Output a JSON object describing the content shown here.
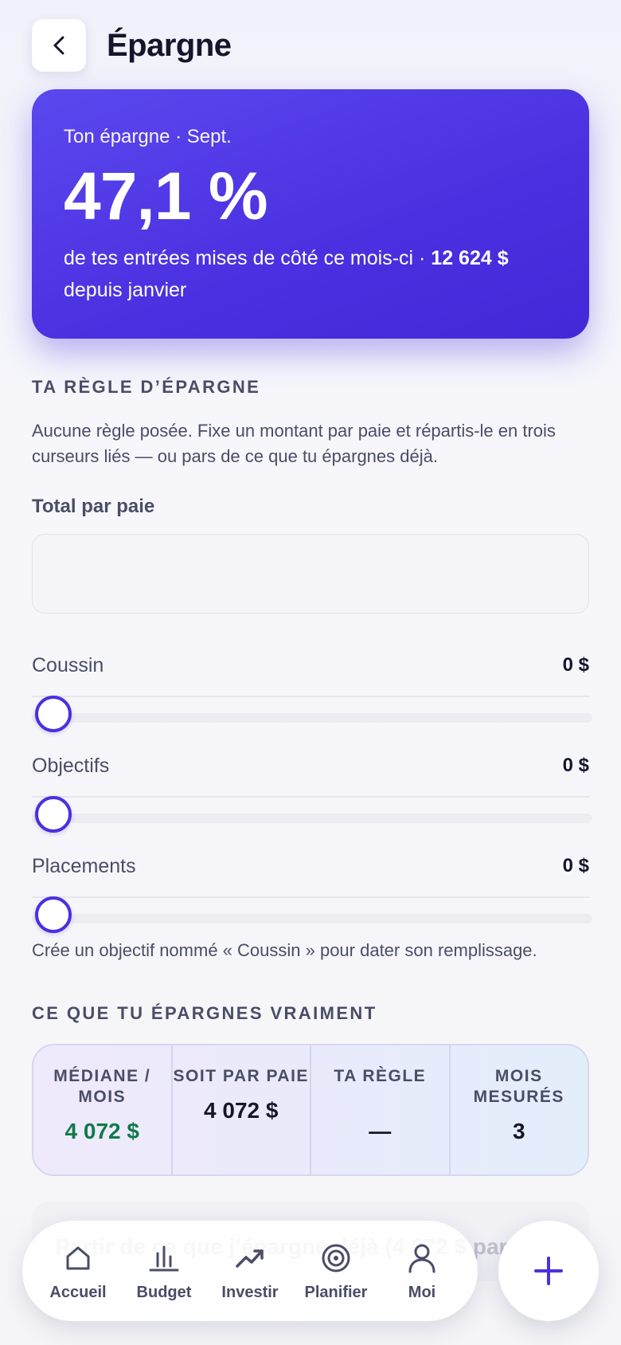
{
  "header": {
    "title": "Épargne"
  },
  "hero": {
    "label": "Ton épargne · Sept.",
    "value": "47,1 %",
    "sub_text": "de tes entrées mises de côté ce mois-ci · ",
    "sub_amount": "12 624 $",
    "sub_tail": " depuis janvier"
  },
  "rule": {
    "title": "TA RÈGLE D’ÉPARGNE",
    "intro": "Aucune règle posée. Fixe un montant par paie et répartis-le en trois curseurs liés — ou pars de ce que tu épargnes déjà.",
    "total_label": "Total par paie",
    "total_value": "",
    "sliders": [
      {
        "name": "Coussin",
        "value": "0 $",
        "level": 0
      },
      {
        "name": "Objectifs",
        "value": "0 $",
        "level": 0
      },
      {
        "name": "Placements",
        "value": "0 $",
        "level": 0
      }
    ],
    "hint": "Crée un objectif nommé « Coussin » pour dater son remplissage."
  },
  "actual": {
    "title": "CE QUE TU ÉPARGNES VRAIMENT",
    "stats": [
      {
        "label": "MÉDIANE / MOIS",
        "value": "4 072 $"
      },
      {
        "label": "SOIT PAR PAIE",
        "value": "4 072 $"
      },
      {
        "label": "TA RÈGLE",
        "value": "—"
      },
      {
        "label": "MOIS MESURÉS",
        "value": "3"
      }
    ],
    "start_button": "Partir de ce que j’épargne déjà (4 072 $ par paie)"
  },
  "nav": {
    "items": [
      {
        "label": "Accueil",
        "icon": "home-icon"
      },
      {
        "label": "Budget",
        "icon": "bar-chart-icon"
      },
      {
        "label": "Investir",
        "icon": "trend-up-icon"
      },
      {
        "label": "Planifier",
        "icon": "target-icon"
      },
      {
        "label": "Moi",
        "icon": "user-icon"
      }
    ]
  },
  "colors": {
    "accent": "#4a30e0",
    "positive": "#0f7a4a",
    "muted": "#4a4d66"
  }
}
